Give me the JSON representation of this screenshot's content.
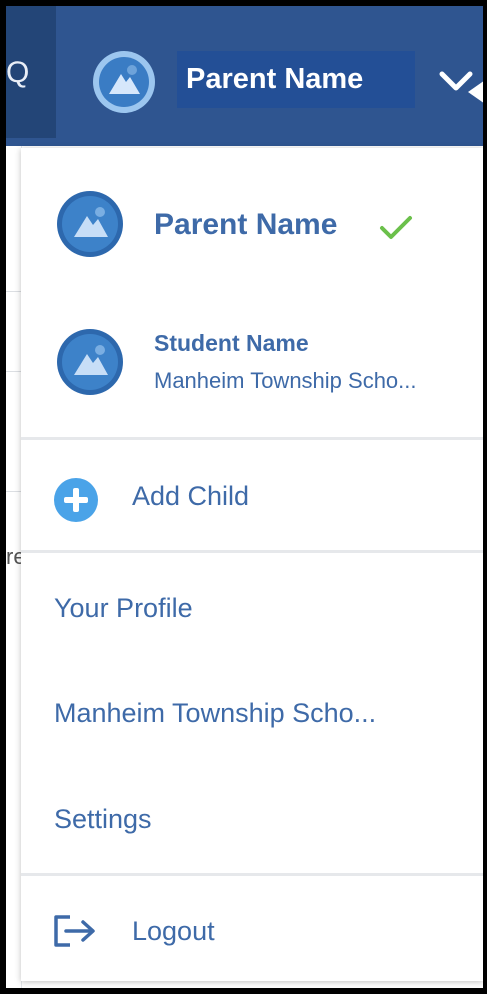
{
  "header": {
    "user_name": "Parent Name",
    "search_glyph": "Q",
    "icons": [
      "search-icon",
      "avatar-icon",
      "chevron-down-icon"
    ]
  },
  "menu": {
    "accounts": [
      {
        "name": "Parent Name",
        "selected": true,
        "icon": "check-icon"
      },
      {
        "name": "Student Name",
        "subtitle": "Manheim Township Scho..."
      }
    ],
    "add_child": {
      "label": "Add Child",
      "icon": "plus-circle-icon"
    },
    "links": [
      "Your Profile",
      "Manheim Township Scho...",
      "Settings"
    ],
    "logout": {
      "label": "Logout",
      "icon": "logout-icon"
    }
  },
  "background": {
    "partial_char": "re"
  },
  "colors": {
    "header_bg": "#2f5590",
    "header_dark": "#234577",
    "text_blue": "#3e6aa8",
    "check_green": "#6bc04b",
    "add_blue": "#4aa3e8"
  }
}
